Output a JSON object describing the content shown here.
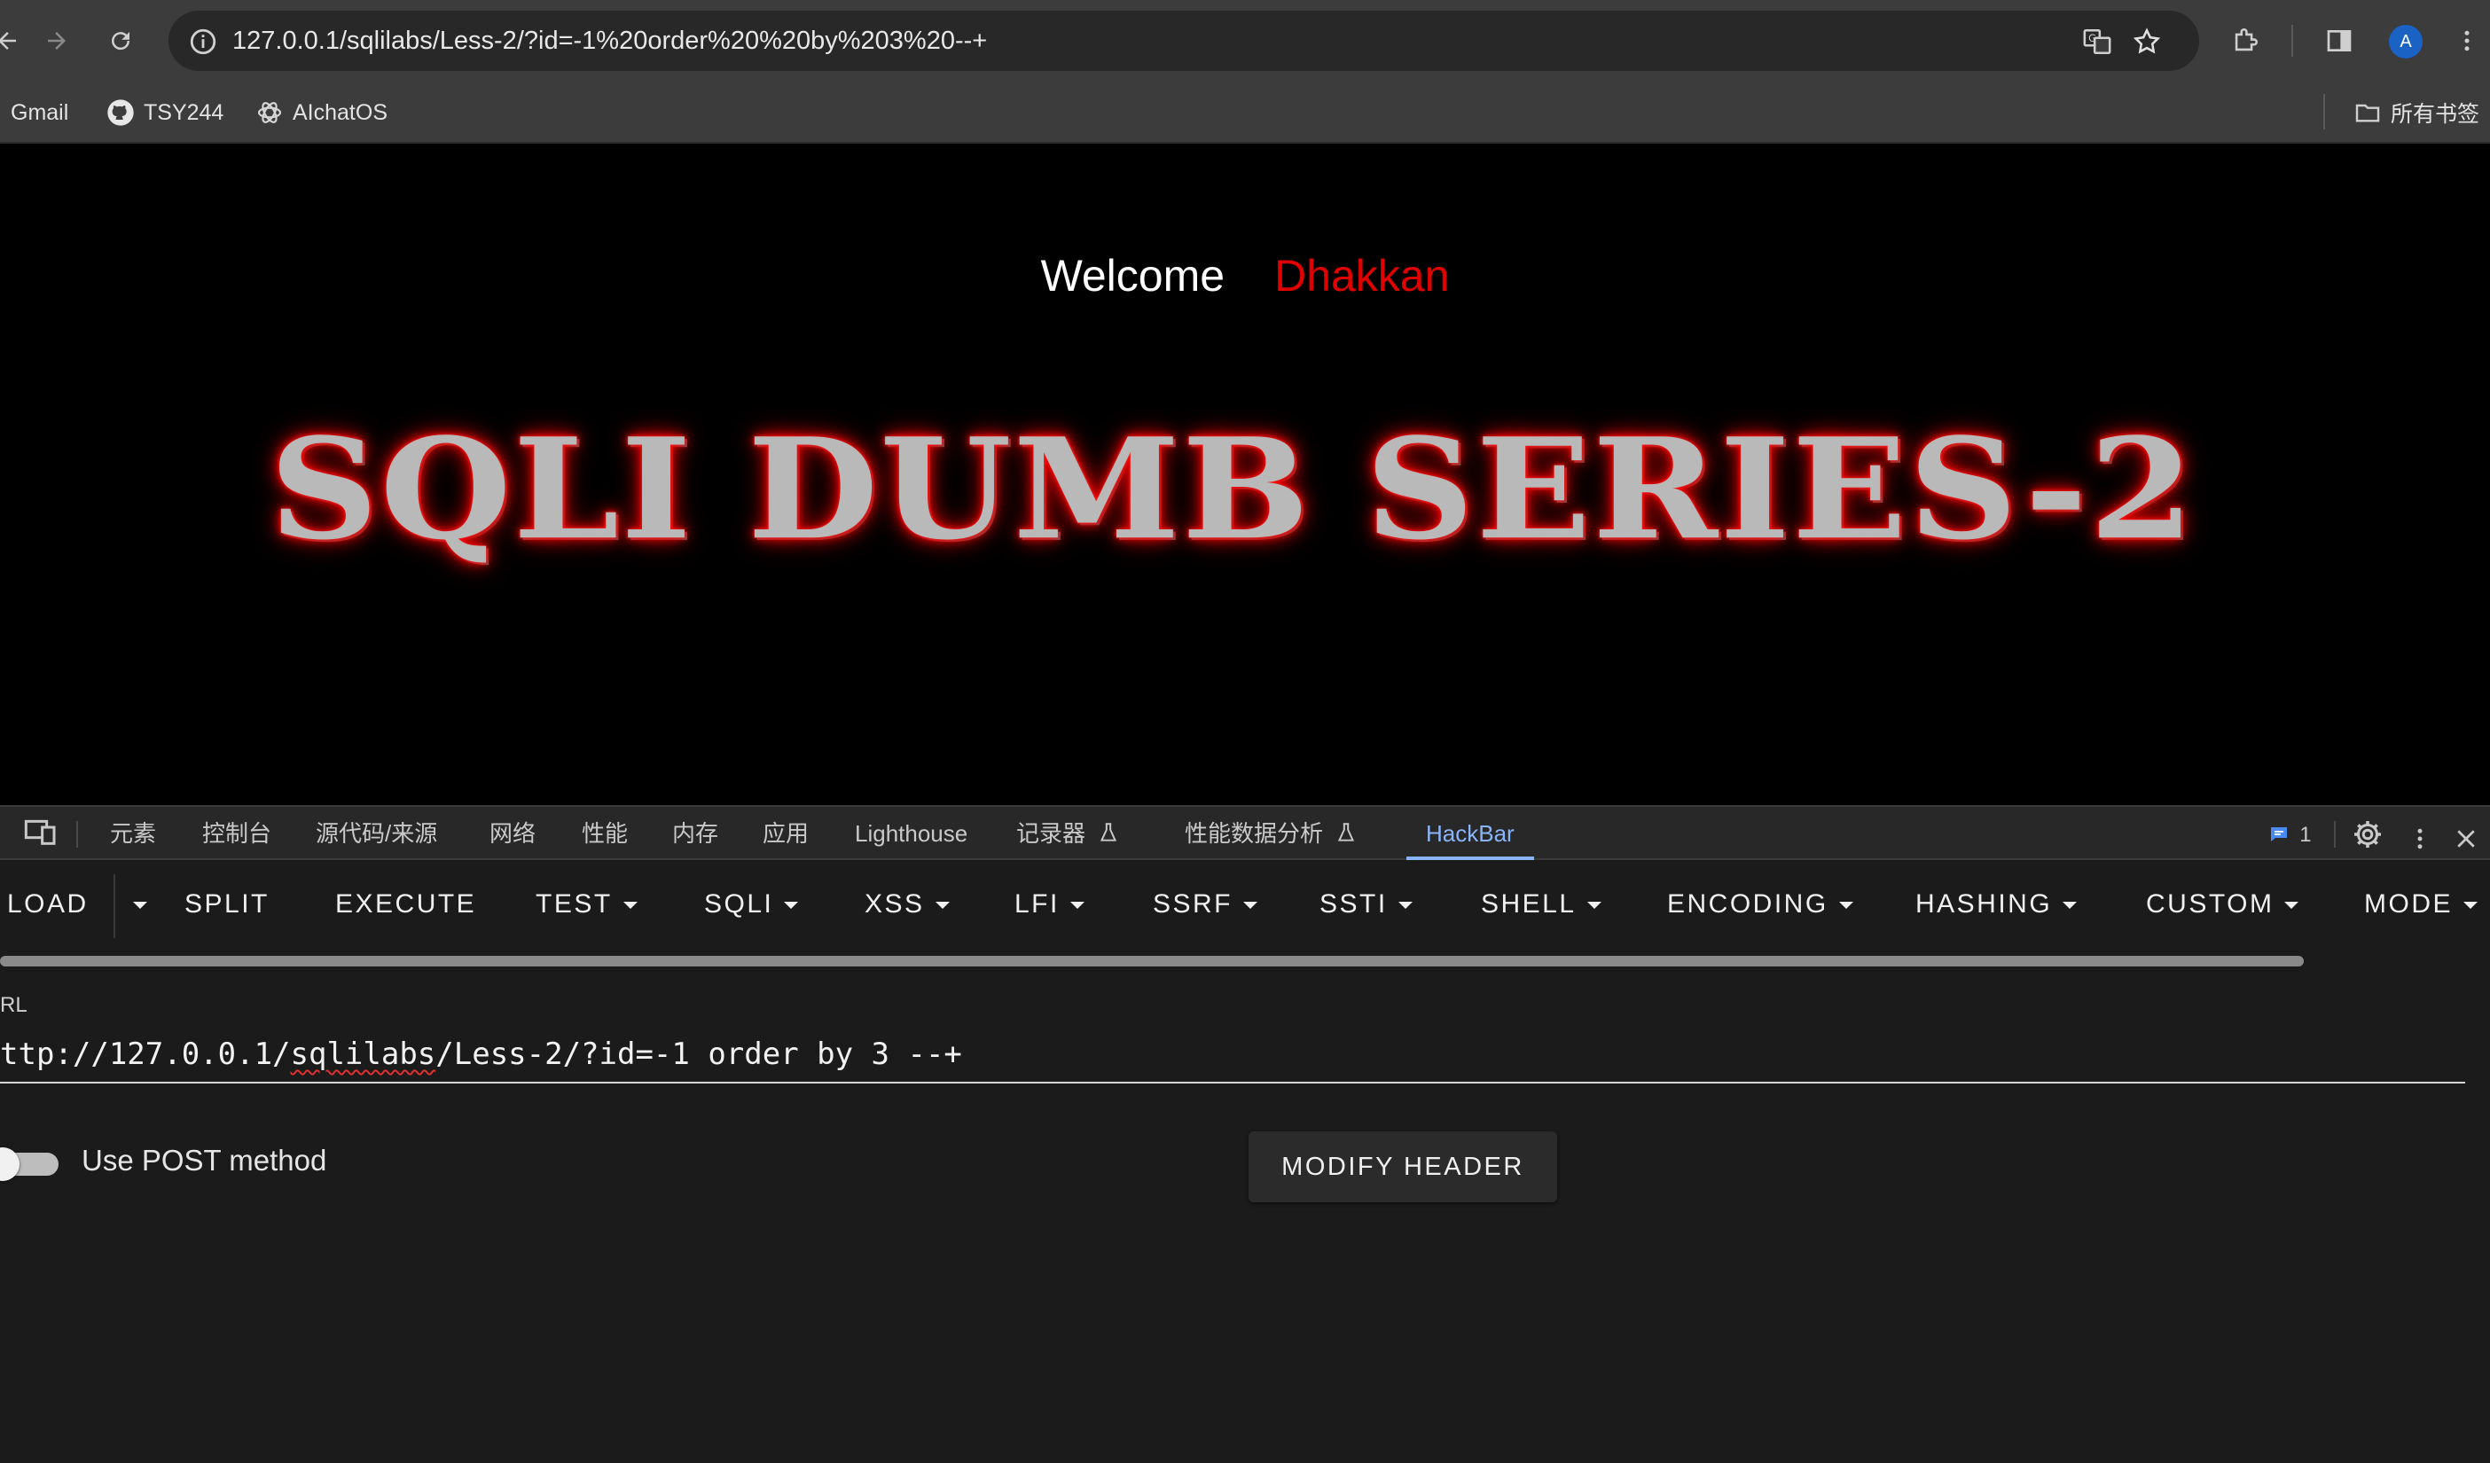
{
  "browser": {
    "url": "127.0.0.1/sqlilabs/Less-2/?id=-1%20order%20%20by%203%20--+",
    "avatar_letter": "A",
    "bookmarks": [
      {
        "label": "Gmail",
        "icon": "gmail-icon"
      },
      {
        "label": "TSY244",
        "icon": "github-icon"
      },
      {
        "label": "AIchatOS",
        "icon": "openai-icon"
      }
    ],
    "all_bookmarks_label": "所有书签"
  },
  "page": {
    "welcome": "Welcome",
    "user": "Dhakkan",
    "banner": "SQLI DUMB SERIES-2"
  },
  "devtools": {
    "tabs": [
      "元素",
      "控制台",
      "源代码/来源",
      "网络",
      "性能",
      "内存",
      "应用",
      "Lighthouse",
      "记录器",
      "性能数据分析",
      "HackBar"
    ],
    "active_tab": "HackBar",
    "issues_count": "1"
  },
  "hackbar": {
    "menu": {
      "load": "LOAD",
      "split": "SPLIT",
      "execute": "EXECUTE",
      "test": "TEST",
      "sqli": "SQLI",
      "xss": "XSS",
      "lfi": "LFI",
      "ssrf": "SSRF",
      "ssti": "SSTI",
      "shell": "SHELL",
      "encoding": "ENCODING",
      "hashing": "HASHING",
      "custom": "CUSTOM",
      "mode": "MODE"
    },
    "url_label": "RL",
    "url_prefix": "ttp://127.0.0.1/",
    "url_squiggle": "sqlilabs",
    "url_suffix": "/Less-2/?id=-1 order  by 3 --+",
    "post_label": "Use POST method",
    "post_enabled": false,
    "modify_header": "MODIFY HEADER"
  },
  "colors": {
    "accent": "#8ab4f8",
    "user_red": "#e00000",
    "banner_glow": "#ff0000"
  }
}
